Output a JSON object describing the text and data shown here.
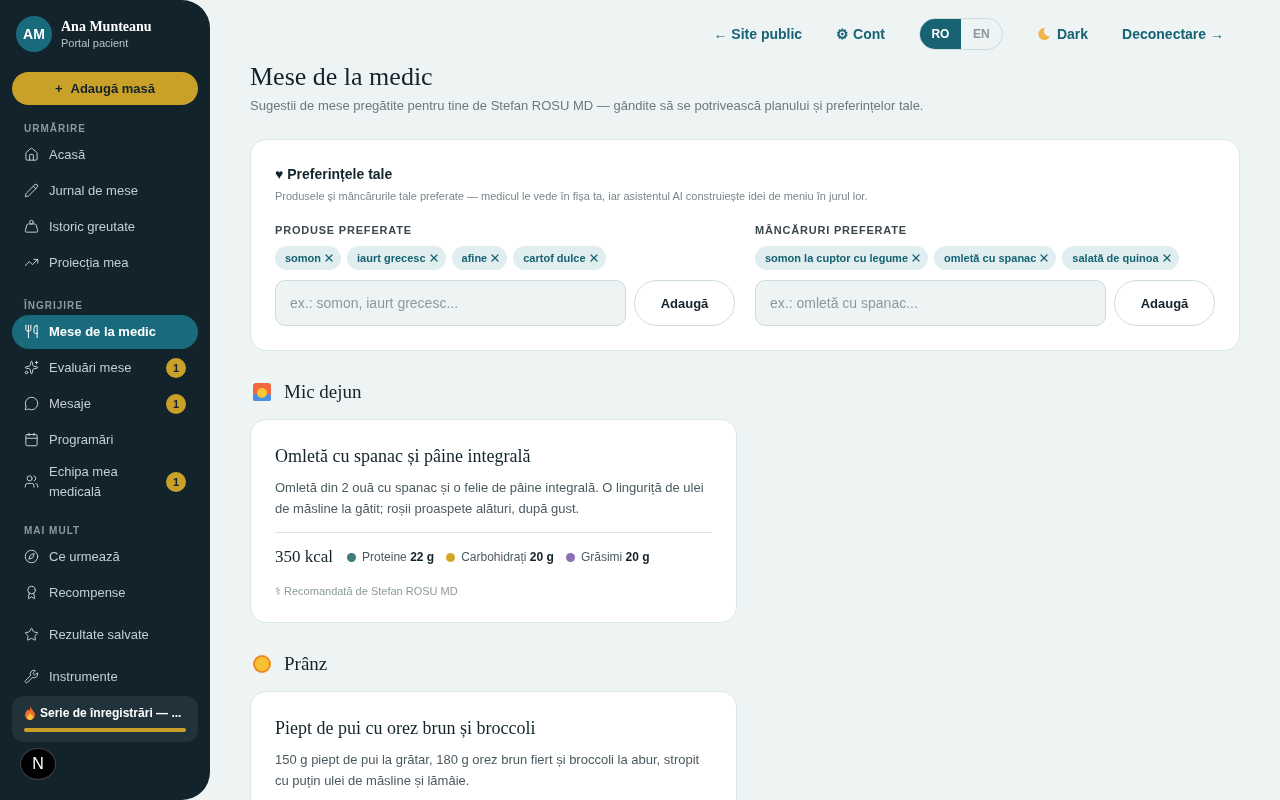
{
  "user": {
    "initials": "AM",
    "name": "Ana Munteanu",
    "role": "Portal pacient"
  },
  "add_meal_button": {
    "icon": "+",
    "label": "Adaugă masă"
  },
  "sidebar": {
    "sections": [
      {
        "title": "URMĂRIRE",
        "items": [
          {
            "label": "Acasă",
            "selected": false
          },
          {
            "label": "Jurnal de mese",
            "selected": false
          },
          {
            "label": "Istoric greutate",
            "selected": false
          },
          {
            "label": "Proiecția mea",
            "selected": false
          }
        ]
      },
      {
        "title": "ÎNGRIJIRE",
        "items": [
          {
            "label": "Mese de la medic",
            "selected": true
          },
          {
            "label": "Evaluări mese",
            "selected": false,
            "badge": "1"
          },
          {
            "label": "Mesaje",
            "selected": false,
            "badge": "1"
          },
          {
            "label": "Programări",
            "selected": false
          },
          {
            "label": "Echipa mea medicală",
            "selected": false,
            "badge": "1"
          }
        ]
      },
      {
        "title": "MAI MULT",
        "items": [
          {
            "label": "Ce urmează",
            "selected": false
          },
          {
            "label": "Recompense",
            "selected": false
          },
          {
            "label": "Rezultate salvate",
            "selected": false
          },
          {
            "label": "Instrumente",
            "selected": false
          }
        ]
      }
    ]
  },
  "streak": {
    "label": "Serie de înregistrări — ...",
    "level": 1
  },
  "bottom_badge": "N",
  "topbar": {
    "site_link": "← Site public",
    "account_link": "⚙ Cont",
    "languages": [
      {
        "label": "RO",
        "selected": true
      },
      {
        "label": "EN",
        "selected": false
      }
    ],
    "theme_toggle": "Dark",
    "logout_link": "Deconectare →"
  },
  "page": {
    "title": "Mese de la medic",
    "subtitle": "Sugestii de mese pregătite pentru tine de Stefan ROSU MD — gândite să se potrivească planului și preferințelor tale."
  },
  "preferences": {
    "title": "♥ Preferințele tale",
    "description": "Produsele și mâncărurile tale preferate — medicul le vede în fișa ta, iar asistentul AI construiește idei de meniu în jurul lor.",
    "groups": [
      {
        "title": "PRODUSE PREFERATE",
        "chips": [
          "somon",
          "iaurt grecesc",
          "afine",
          "cartof dulce"
        ],
        "placeholder": "ex.: somon, iaurt grecesc...",
        "button": "Adaugă"
      },
      {
        "title": "MÂNCĂRURI PREFERATE",
        "chips": [
          "somon la cuptor cu legume",
          "omletă cu spanac",
          "salată de quinoa"
        ],
        "placeholder": "ex.: omletă cu spanac...",
        "button": "Adaugă"
      }
    ]
  },
  "meals": [
    {
      "kind": "sunrise",
      "heading": "Mic dejun",
      "title": "Omletă cu spanac și pâine integrală",
      "description": "Omletă din 2 ouă cu spanac și o felie de pâine integrală. O linguriță de ulei de măsline la gătit; roșii proaspete alături, după gust.",
      "kcal": "350 kcal",
      "macros": [
        {
          "label": "Proteine",
          "value": "22 g",
          "color": "#3f7a80"
        },
        {
          "label": "Carbohidrați",
          "value": "20 g",
          "color": "#d2a429"
        },
        {
          "label": "Grăsimi",
          "value": "20 g",
          "color": "#8d6fb3"
        }
      ],
      "note": "⚕ Recomandată de Stefan ROSU MD"
    },
    {
      "kind": "sun",
      "heading": "Prânz",
      "title": "Piept de pui cu orez brun și broccoli",
      "description": "150 g piept de pui la grătar, 180 g orez brun fiert și broccoli la abur, stropit cu puțin ulei de măsline și lămâie."
    }
  ]
}
